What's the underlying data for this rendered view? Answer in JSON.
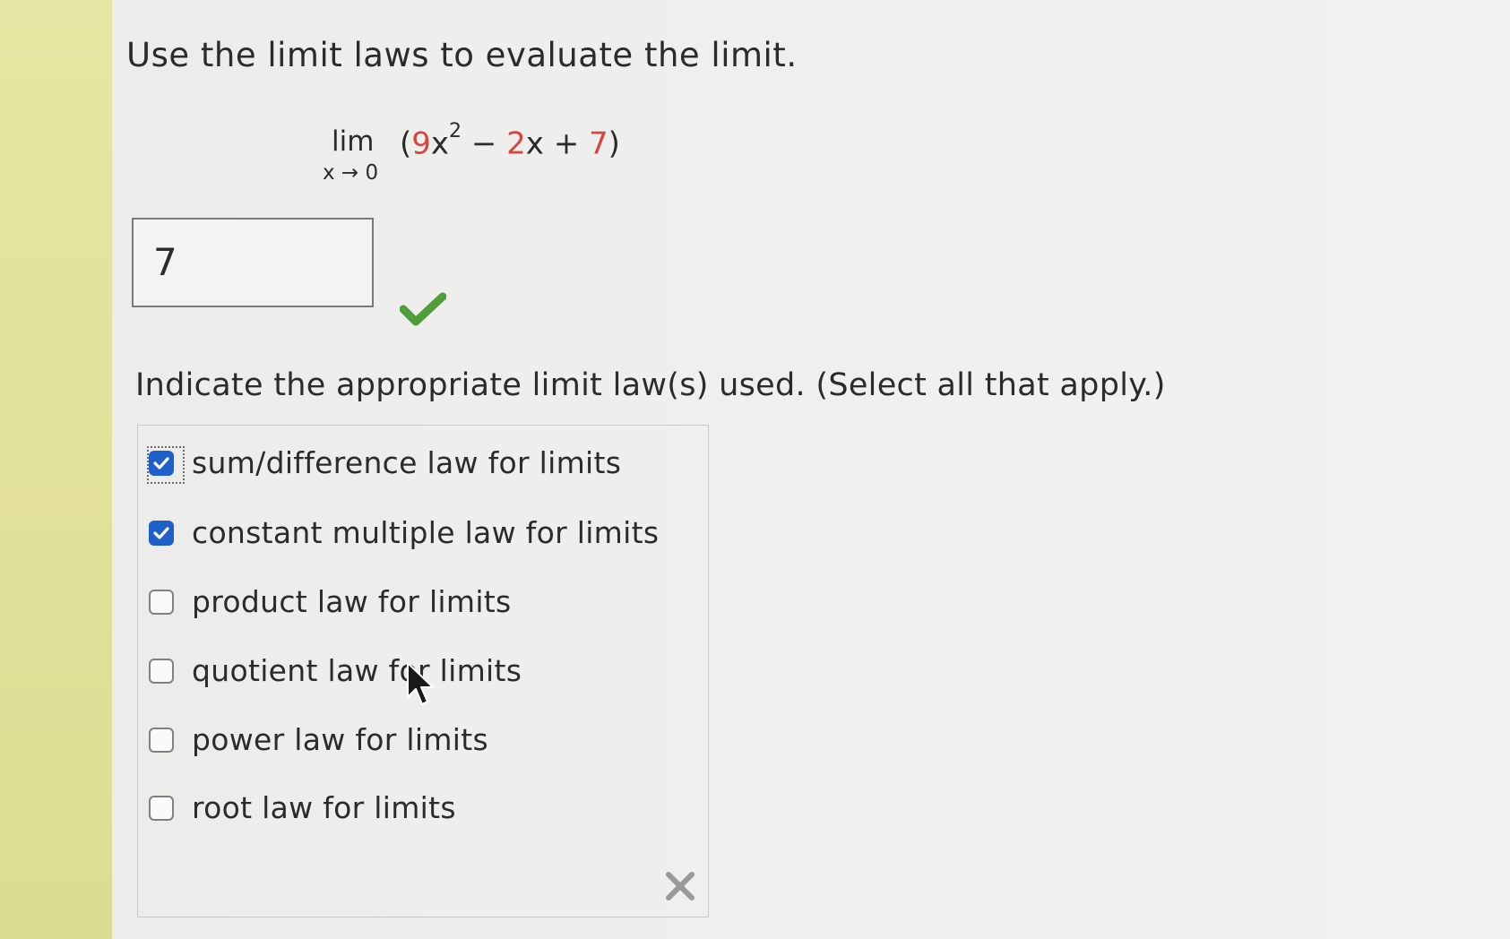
{
  "prompt": "Use the limit laws to evaluate the limit.",
  "limit": {
    "lim": "lim",
    "sub": "x → 0",
    "open_paren": "(",
    "coef_9": "9",
    "x_var": "x",
    "exponent": "2",
    "middle": " − ",
    "term2_coef": "2",
    "term2_var": "x",
    "plus": " + ",
    "const": "7",
    "close_paren": ")"
  },
  "answer": {
    "value": "7",
    "status": "correct"
  },
  "instruction": "Indicate the appropriate limit law(s) used. (Select all that apply.)",
  "options": [
    {
      "label": "sum/difference law for limits",
      "checked": true
    },
    {
      "label": "constant multiple law for limits",
      "checked": true
    },
    {
      "label": "product law for limits",
      "checked": false
    },
    {
      "label": "quotient law for limits",
      "checked": false
    },
    {
      "label": "power law for limits",
      "checked": false
    },
    {
      "label": "root law for limits",
      "checked": false
    }
  ],
  "options_status": "incorrect",
  "colors": {
    "checkbox_checked": "#1f5fc9",
    "correct_mark": "#4f9e3a",
    "incorrect_mark": "#9a9a9a",
    "highlight_text": "#d8443e"
  }
}
